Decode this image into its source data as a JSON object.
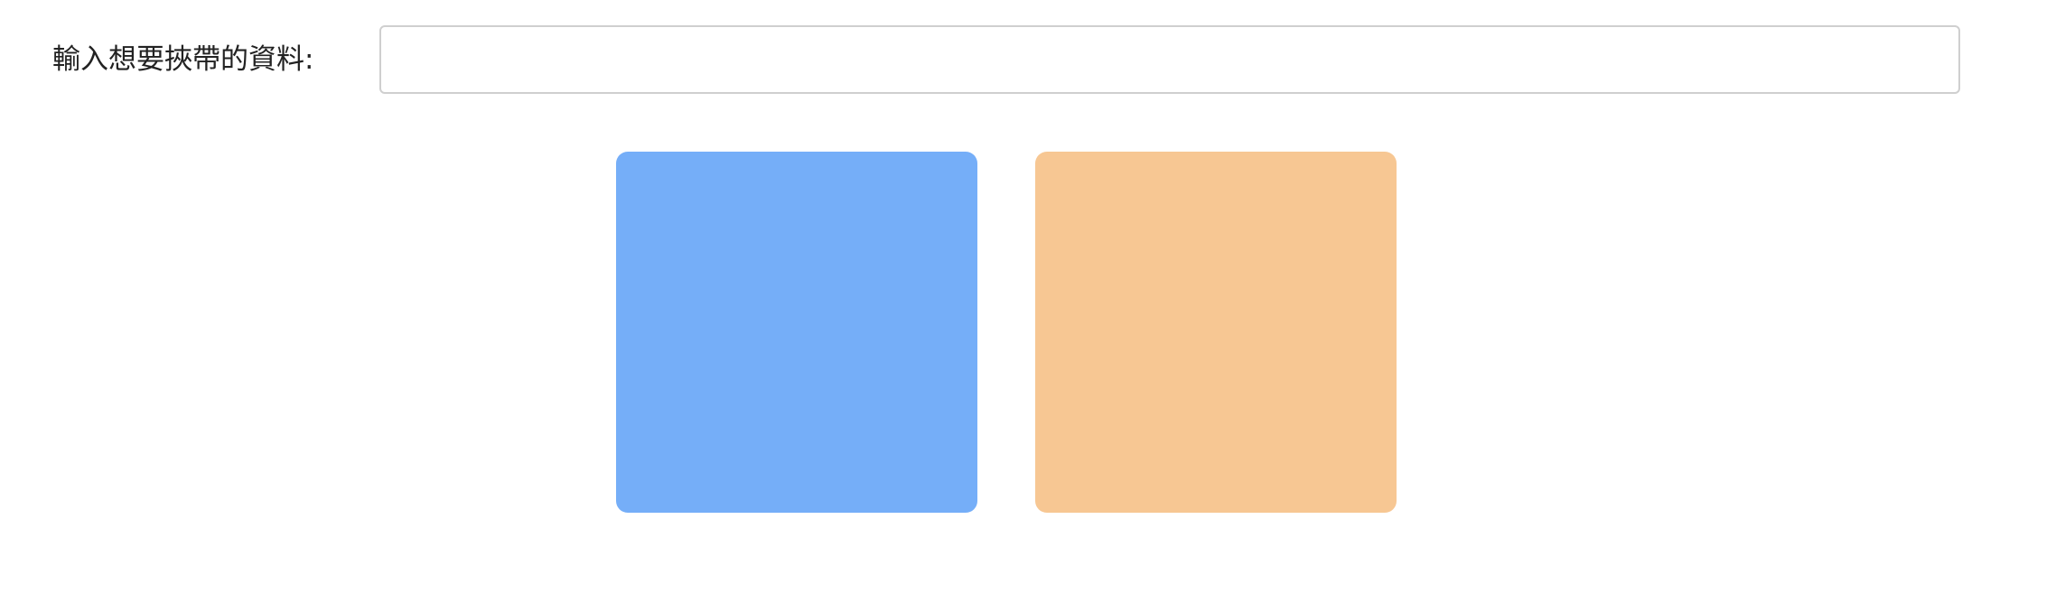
{
  "form": {
    "label": "輸入想要挾帶的資料:",
    "input_value": "",
    "input_placeholder": ""
  },
  "boxes": [
    {
      "name": "blue-box",
      "color": "#75aef8"
    },
    {
      "name": "orange-box",
      "color": "#f7c793"
    }
  ]
}
